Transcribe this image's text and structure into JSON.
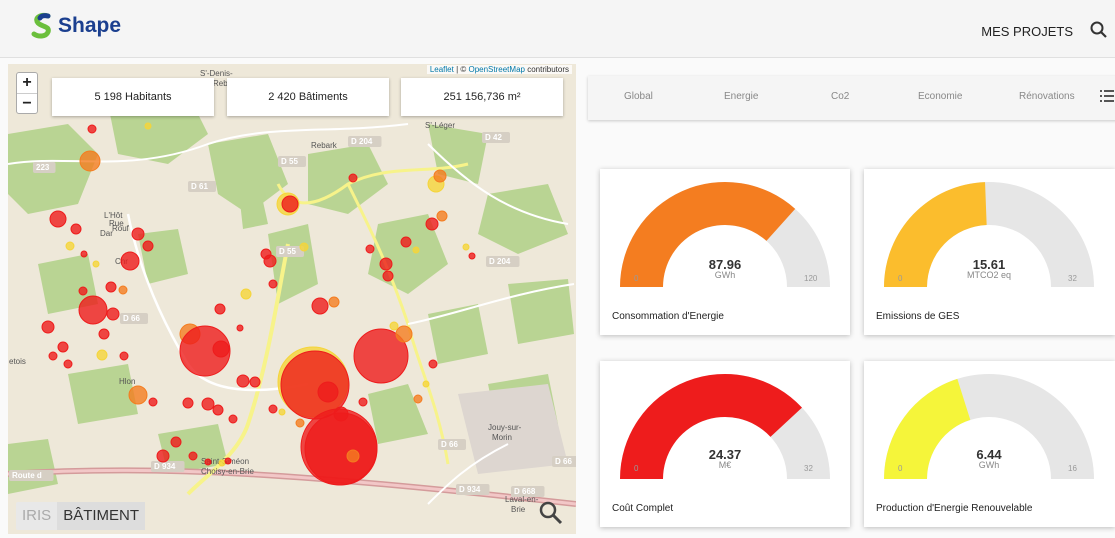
{
  "header": {
    "logo_text": "Shape",
    "nav_projects": "MES PROJETS"
  },
  "map": {
    "attribution_link": "Leaflet",
    "attribution_sep": " | © ",
    "attribution_osm": "OpenStreetMap",
    "attribution_tail": " contributors",
    "zoom_in": "+",
    "zoom_out": "−",
    "stats": {
      "inhabitants": "5 198 Habitants",
      "buildings": "2 420 Bâtiments",
      "area": "251 156,736 m²"
    },
    "layers": {
      "iris": "IRIS",
      "batiment": "BÂTIMENT"
    },
    "place_labels": [
      "S'-Denis-",
      "Reb",
      "S'-Léger",
      "Rebark",
      "Jouy-sur-",
      "Morin",
      "Laval-en-",
      "Brie",
      "Saint-Siméon",
      "Choisy-en-Brie",
      "etois",
      "Hlon",
      "Chr",
      "L'Hôt",
      "Dar",
      "Rue",
      "Rouf"
    ],
    "road_labels": [
      "D 204",
      "D 42",
      "D 55",
      "D 61",
      "D 204",
      "D 66",
      "D 934",
      "D 934",
      "D 66",
      "D 66",
      "D 668",
      "D 55",
      "223",
      "Route d"
    ]
  },
  "tabs": [
    "Global",
    "Energie",
    "Co2",
    "Economie",
    "Rénovations"
  ],
  "cards": [
    {
      "value": "87.96",
      "unit": "GWh",
      "min": "0",
      "max": "120",
      "fraction": 0.733,
      "color": "#f47d20",
      "label": "Consommation d'Energie"
    },
    {
      "value": "15.61",
      "unit": "MTCO2 eq",
      "min": "0",
      "max": "32",
      "fraction": 0.488,
      "color": "#fbbd2d",
      "label": "Emissions de GES"
    },
    {
      "value": "24.37",
      "unit": "M€",
      "min": "0",
      "max": "32",
      "fraction": 0.762,
      "color": "#ee1c1c",
      "label": "Coût Complet"
    },
    {
      "value": "6.44",
      "unit": "GWh",
      "min": "0",
      "max": "16",
      "fraction": 0.4025,
      "color": "#f5f53a",
      "label": "Production d'Energie Renouvelable"
    }
  ],
  "colors": {
    "brand": "#1b3f8f",
    "logo_green": "#6bbf3c",
    "map_bg": "#eee8d9",
    "forest": "#b9d493",
    "marker_red": "#ee1c1c",
    "marker_orange": "#f47d20",
    "marker_yellow": "#f5d53a"
  }
}
